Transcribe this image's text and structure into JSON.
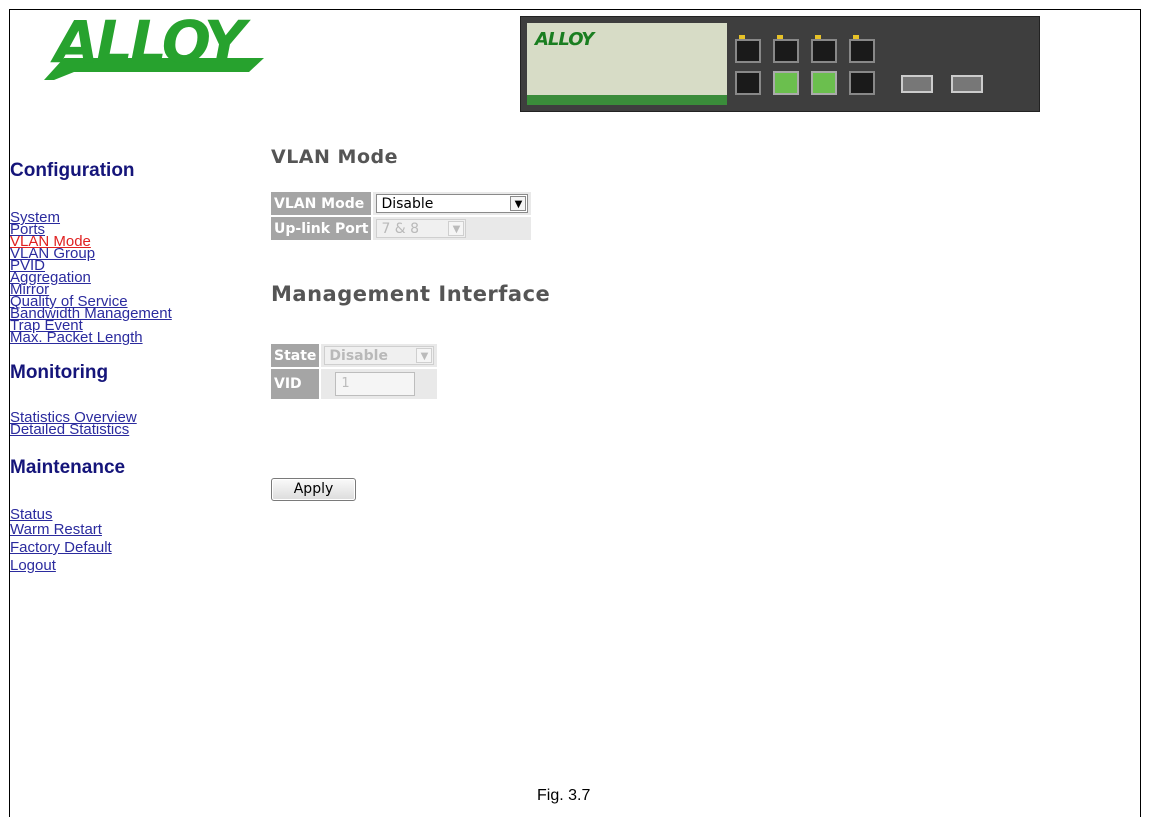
{
  "logo": {
    "brand": "ALLOY"
  },
  "device": {
    "brand": "ALLOY"
  },
  "sidebar": {
    "configuration": {
      "title": "Configuration",
      "items": [
        "System",
        "Ports",
        "VLAN Mode",
        "VLAN Group",
        "PVID",
        "Aggregation",
        "Mirror",
        "Quality of Service",
        "Bandwidth Management",
        "Trap Event",
        "Max. Packet Length"
      ]
    },
    "monitoring": {
      "title": "Monitoring",
      "items": [
        "Statistics Overview",
        "Detailed Statistics"
      ]
    },
    "maintenance": {
      "title": "Maintenance",
      "items": [
        "Status",
        "Warm Restart",
        "Factory Default",
        "Logout"
      ]
    }
  },
  "main": {
    "title": "VLAN Mode",
    "vlan_mode_label": "VLAN Mode",
    "vlan_mode_value": "Disable",
    "uplink_port_label": "Up-link Port",
    "uplink_port_value": "7 & 8",
    "mgmt_title": "Management Interface",
    "state_label": "State",
    "state_value": "Disable",
    "vid_label": "VID",
    "vid_value": "1",
    "apply_label": "Apply"
  },
  "caption": "Fig. 3.7",
  "colors": {
    "logo_green": "#27a22e",
    "section_title": "#15157a",
    "link": "#2b2b9e",
    "active_link": "#e02020",
    "label_bg": "#a5a5a5"
  }
}
